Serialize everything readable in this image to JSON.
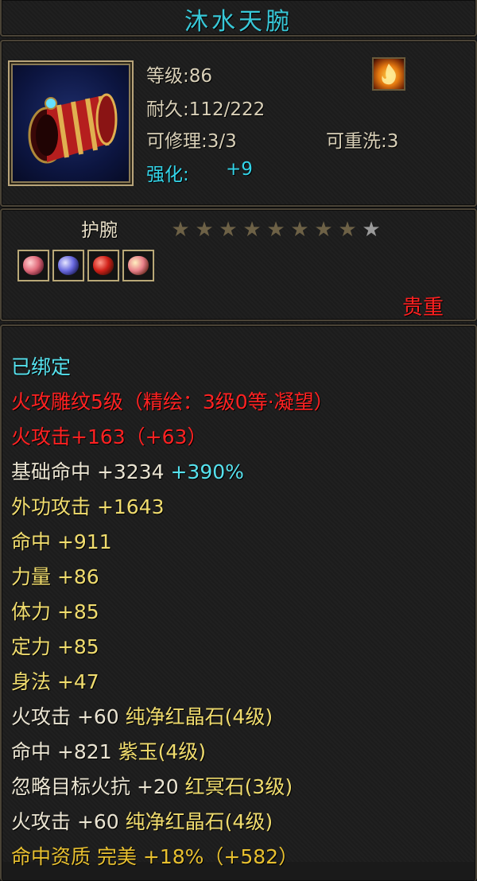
{
  "item": {
    "name": "沐水天腕",
    "level": "等级:86",
    "durability": "耐久:112/222",
    "repairable": "可修理:3/3",
    "rewash": "可重洗:3",
    "enhance_label": "强化:",
    "enhance_value": "+9",
    "type": "护腕",
    "rarity": "贵重",
    "stars": {
      "filled": 8,
      "total": 9
    },
    "gems": [
      "pink-gem",
      "blue-gem",
      "red-gem",
      "pink-gem"
    ],
    "element_icon": "fire-element-icon"
  },
  "stats": [
    {
      "segments": [
        {
          "text": "已绑定",
          "color": "cyan"
        }
      ]
    },
    {
      "segments": [
        {
          "text": "火攻雕纹5级（精绘：3级0等·凝望）",
          "color": "red"
        }
      ]
    },
    {
      "segments": [
        {
          "text": "火攻击+163（+63）",
          "color": "red"
        }
      ]
    },
    {
      "segments": [
        {
          "text": "基础命中 +3234 ",
          "color": "white"
        },
        {
          "text": "+390%",
          "color": "cyan"
        }
      ]
    },
    {
      "segments": [
        {
          "text": "外功攻击 ",
          "color": "gold"
        },
        {
          "text": "+1643",
          "color": "gold"
        }
      ]
    },
    {
      "segments": [
        {
          "text": "命中 ",
          "color": "gold"
        },
        {
          "text": "+911",
          "color": "gold"
        }
      ]
    },
    {
      "segments": [
        {
          "text": "力量 ",
          "color": "gold"
        },
        {
          "text": "+86",
          "color": "gold"
        }
      ]
    },
    {
      "segments": [
        {
          "text": "体力 ",
          "color": "gold"
        },
        {
          "text": "+85",
          "color": "gold"
        }
      ]
    },
    {
      "segments": [
        {
          "text": "定力 ",
          "color": "gold"
        },
        {
          "text": "+85",
          "color": "gold"
        }
      ]
    },
    {
      "segments": [
        {
          "text": "身法 ",
          "color": "gold"
        },
        {
          "text": "+47",
          "color": "gold"
        }
      ]
    },
    {
      "segments": [
        {
          "text": "火攻击 +60 ",
          "color": "white"
        },
        {
          "text": "纯净红晶石(4级)",
          "color": "gold"
        }
      ]
    },
    {
      "segments": [
        {
          "text": "命中 +821 ",
          "color": "white"
        },
        {
          "text": "紫玉(4级)",
          "color": "gold"
        }
      ]
    },
    {
      "segments": [
        {
          "text": "忽略目标火抗 +20 ",
          "color": "white"
        },
        {
          "text": "红冥石(3级)",
          "color": "gold"
        }
      ]
    },
    {
      "segments": [
        {
          "text": "火攻击 +60 ",
          "color": "white"
        },
        {
          "text": "纯净红晶石(4级)",
          "color": "gold"
        }
      ]
    },
    {
      "segments": [
        {
          "text": "命中资质 完美 +18%（+582）",
          "color": "orange"
        }
      ]
    }
  ],
  "colors": {
    "title": "#38c8d8",
    "cyan": "#56e2ee",
    "red": "#ff2222",
    "gold": "#f0dc6e",
    "white": "#eae4d2",
    "orange": "#e8c030",
    "frame": "#b8a47a"
  }
}
